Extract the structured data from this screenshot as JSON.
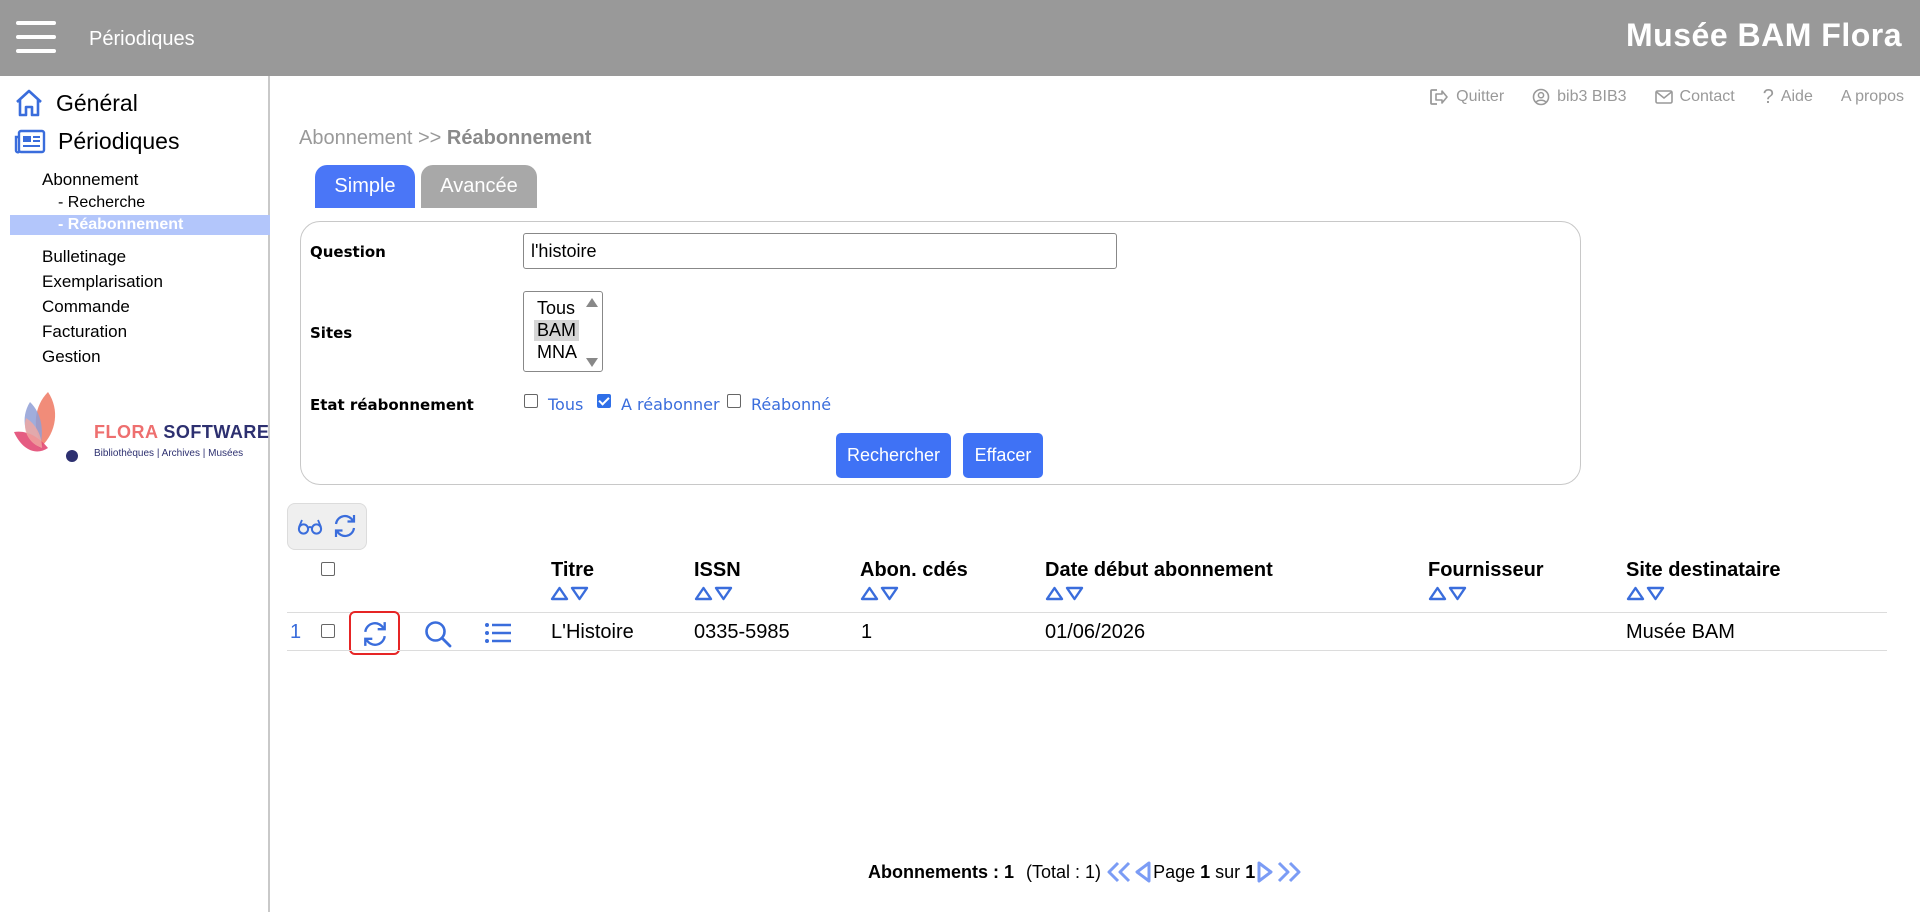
{
  "header": {
    "section_title": "Périodiques",
    "brand": "Musée BAM Flora"
  },
  "sidebar": {
    "general": "Général",
    "periodiques": "Périodiques",
    "abonnement": "Abonnement",
    "recherche": "- Recherche",
    "reabonnement": "- Réabonnement",
    "bulletinage": "Bulletinage",
    "exemplarisation": "Exemplarisation",
    "commande": "Commande",
    "facturation": "Facturation",
    "gestion": "Gestion",
    "logo_part1": "FLORA",
    "logo_part2": " SOFTWARE",
    "logo_tagline": "Bibliothèques | Archives | Musées"
  },
  "toplinks": {
    "quitter": "Quitter",
    "user": "bib3 BIB3",
    "contact": "Contact",
    "aide": "Aide",
    "apropos": "A propos"
  },
  "breadcrumb": {
    "parent": "Abonnement",
    "separator": " >> ",
    "current": "Réabonnement"
  },
  "tabs": {
    "simple": "Simple",
    "advanced": "Avancée"
  },
  "form": {
    "question_label": "Question",
    "question_value": "l'histoire",
    "sites_label": "Sites",
    "sites_options": [
      "Tous",
      "BAM",
      "MNA"
    ],
    "sites_selected": "BAM",
    "etat_label": "Etat réabonnement",
    "etat_tous": "Tous",
    "etat_a_reabonner": "A réabonner",
    "etat_reabonne": "Réabonné",
    "search_button": "Rechercher",
    "clear_button": "Effacer"
  },
  "table": {
    "headers": {
      "titre": "Titre",
      "issn": "ISSN",
      "abon": "Abon. cdés",
      "date": "Date début abonnement",
      "fournisseur": "Fournisseur",
      "site": "Site destinataire"
    },
    "rows": [
      {
        "num": "1",
        "titre": "L'Histoire",
        "issn": "0335-5985",
        "abon": "1",
        "date": "01/06/2026",
        "fournisseur": "",
        "site": "Musée BAM"
      }
    ]
  },
  "pager": {
    "label": "Abonnements",
    "colon": " : ",
    "count": "1",
    "total": "(Total : 1)",
    "page_word": "Page",
    "page_current": "1",
    "sur_word": "sur",
    "page_total": "1"
  },
  "colors": {
    "accent": "#3f72f5",
    "header_bg": "#999999",
    "highlight": "#e62525"
  }
}
